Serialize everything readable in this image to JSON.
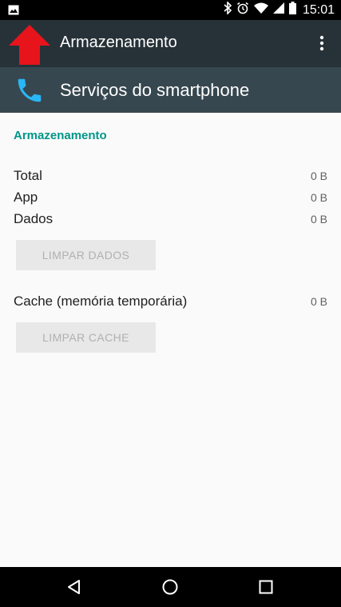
{
  "status_bar": {
    "time": "15:01",
    "icons": [
      "image-icon",
      "bluetooth-icon",
      "alarm-icon",
      "wifi-icon",
      "signal-icon",
      "battery-icon"
    ]
  },
  "app_bar": {
    "title": "Armazenamento",
    "back_icon": "arrow-back-icon",
    "overflow_icon": "more-vert-icon"
  },
  "app_header": {
    "name": "Serviços do smartphone",
    "icon": "phone-icon",
    "icon_color": "#29b6f6"
  },
  "storage": {
    "section_title": "Armazenamento",
    "rows": [
      {
        "label": "Total",
        "value": "0 B"
      },
      {
        "label": "App",
        "value": "0 B"
      },
      {
        "label": "Dados",
        "value": "0 B"
      }
    ],
    "clear_data_label": "LIMPAR DADOS",
    "cache": {
      "label": "Cache (memória temporária)",
      "value": "0 B"
    },
    "clear_cache_label": "LIMPAR CACHE"
  },
  "colors": {
    "accent": "#009688",
    "app_bar": "#263238",
    "header": "#37474f",
    "overlay_arrow": "#e8141b"
  },
  "nav_bar": {
    "icons": [
      "back-triangle-icon",
      "home-circle-icon",
      "recents-square-icon"
    ]
  }
}
